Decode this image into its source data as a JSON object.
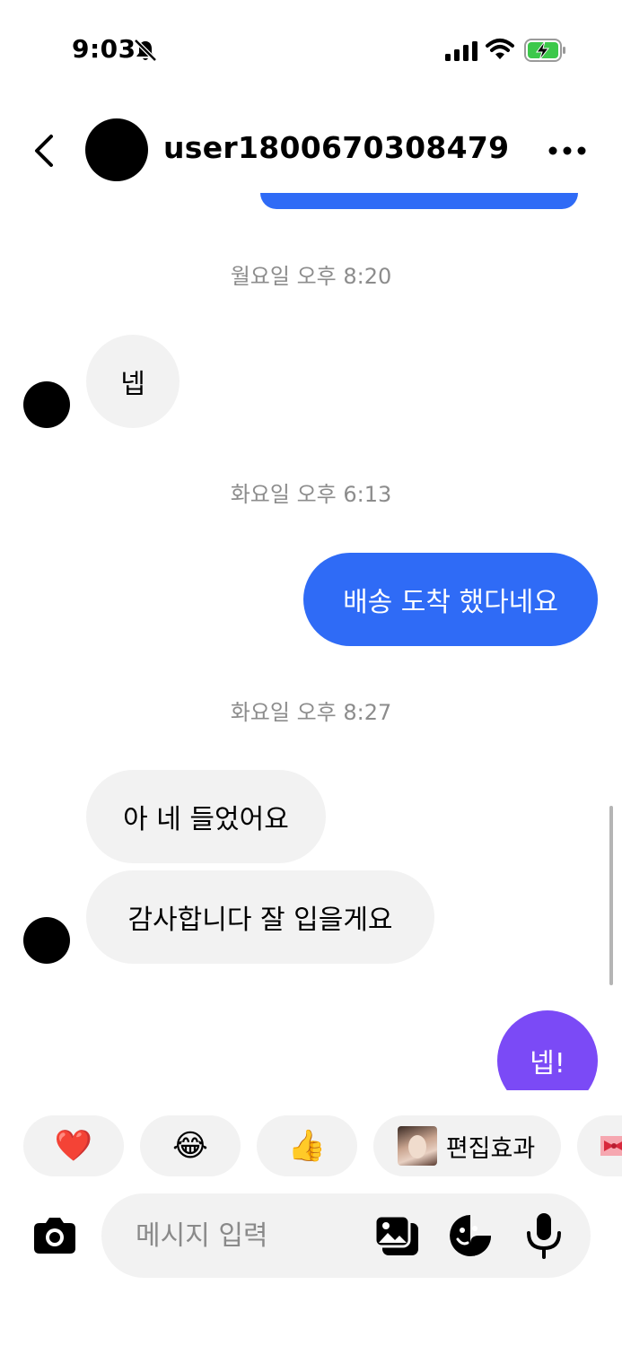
{
  "status_bar": {
    "time": "9:03",
    "icons": [
      "bell-slash-icon",
      "cellular-signal-icon",
      "wifi-icon",
      "battery-charging-icon"
    ],
    "battery_color": "#3cc84a"
  },
  "header": {
    "username": "user1800670308479",
    "icons": [
      "chevron-left-icon",
      "more-horizontal-icon"
    ]
  },
  "messages": {
    "timestamp_1": "월요일 오후 8:20",
    "msg_1": "넵",
    "timestamp_2": "화요일 오후 6:13",
    "msg_2": "배송 도착 했다네요",
    "timestamp_3": "화요일 오후 8:27",
    "msg_3": "아 네 들었어요",
    "msg_4": "감사합니다 잘 입을게요",
    "msg_5": "넵!"
  },
  "quick_reactions": {
    "heart": "❤️",
    "laugh": "😂",
    "thumbs_up": "👍",
    "effect_label": "편집효과"
  },
  "composer": {
    "placeholder": "메시지 입력",
    "icons": [
      "camera-icon",
      "gallery-icon",
      "sticker-icon",
      "microphone-icon"
    ]
  },
  "colors": {
    "outgoing_bubble": "#2f6bf6",
    "outgoing_bubble_last": "#7b4af6",
    "incoming_bubble": "#f2f2f2",
    "timestamp_text": "#8c8c8c"
  }
}
